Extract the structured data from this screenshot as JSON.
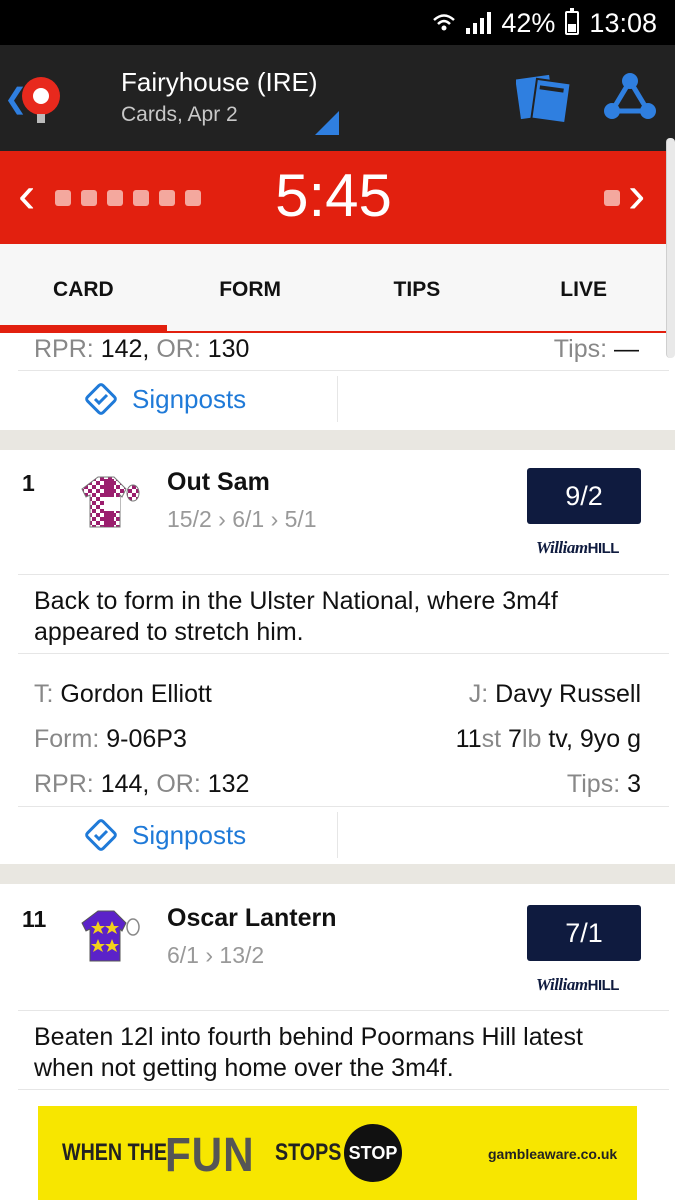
{
  "status_bar": {
    "battery": "42%",
    "time": "13:08"
  },
  "header": {
    "venue": "Fairyhouse (IRE)",
    "subtitle": "Cards, Apr 2"
  },
  "race": {
    "time": "5:45"
  },
  "tabs": [
    {
      "label": "CARD",
      "active": true
    },
    {
      "label": "FORM",
      "active": false
    },
    {
      "label": "TIPS",
      "active": false
    },
    {
      "label": "LIVE",
      "active": false
    }
  ],
  "previous_runner": {
    "rpr_label": "RPR:",
    "rpr": "142,",
    "or_label": "OR:",
    "or": "130",
    "tips_label": "Tips:",
    "tips": "—",
    "signposts": "Signposts"
  },
  "runners": [
    {
      "number": "1",
      "name": "Out Sam",
      "odds_history": "15/2 › 6/1 › 5/1",
      "odds": "9/2",
      "bookmaker_a": "William",
      "bookmaker_b": "HILL",
      "comment": "Back to form in the Ulster National, where 3m4f appeared to stretch him.",
      "trainer_label": "T:",
      "trainer": "Gordon Elliott",
      "jockey_label": "J:",
      "jockey": "Davy Russell",
      "form_label": "Form:",
      "form": "9-06P3",
      "weight_st": "11",
      "st": "st",
      "weight_lb": "7",
      "lb": "lb",
      "extra": "tv, 9yo g",
      "rpr_label": "RPR:",
      "rpr": "144,",
      "or_label": "OR:",
      "or": "132",
      "tips_label": "Tips:",
      "tips": "3",
      "signposts": "Signposts"
    },
    {
      "number": "11",
      "name": "Oscar Lantern",
      "odds_history": "6/1 › 13/2",
      "odds": "7/1",
      "bookmaker_a": "William",
      "bookmaker_b": "HILL",
      "comment": "Beaten 12l into fourth behind Poormans Hill latest when not getting home over the 3m4f."
    }
  ],
  "ad": {
    "line1": "WHEN THE",
    "line2": "FUN",
    "line3": "STOPS",
    "stop": "STOP",
    "site": "gambleaware.co.uk"
  },
  "colors": {
    "brand_red": "#e2200f",
    "header_dark": "#222222",
    "accent_blue": "#2f7fe0",
    "odds_navy": "#0f1b3f"
  }
}
